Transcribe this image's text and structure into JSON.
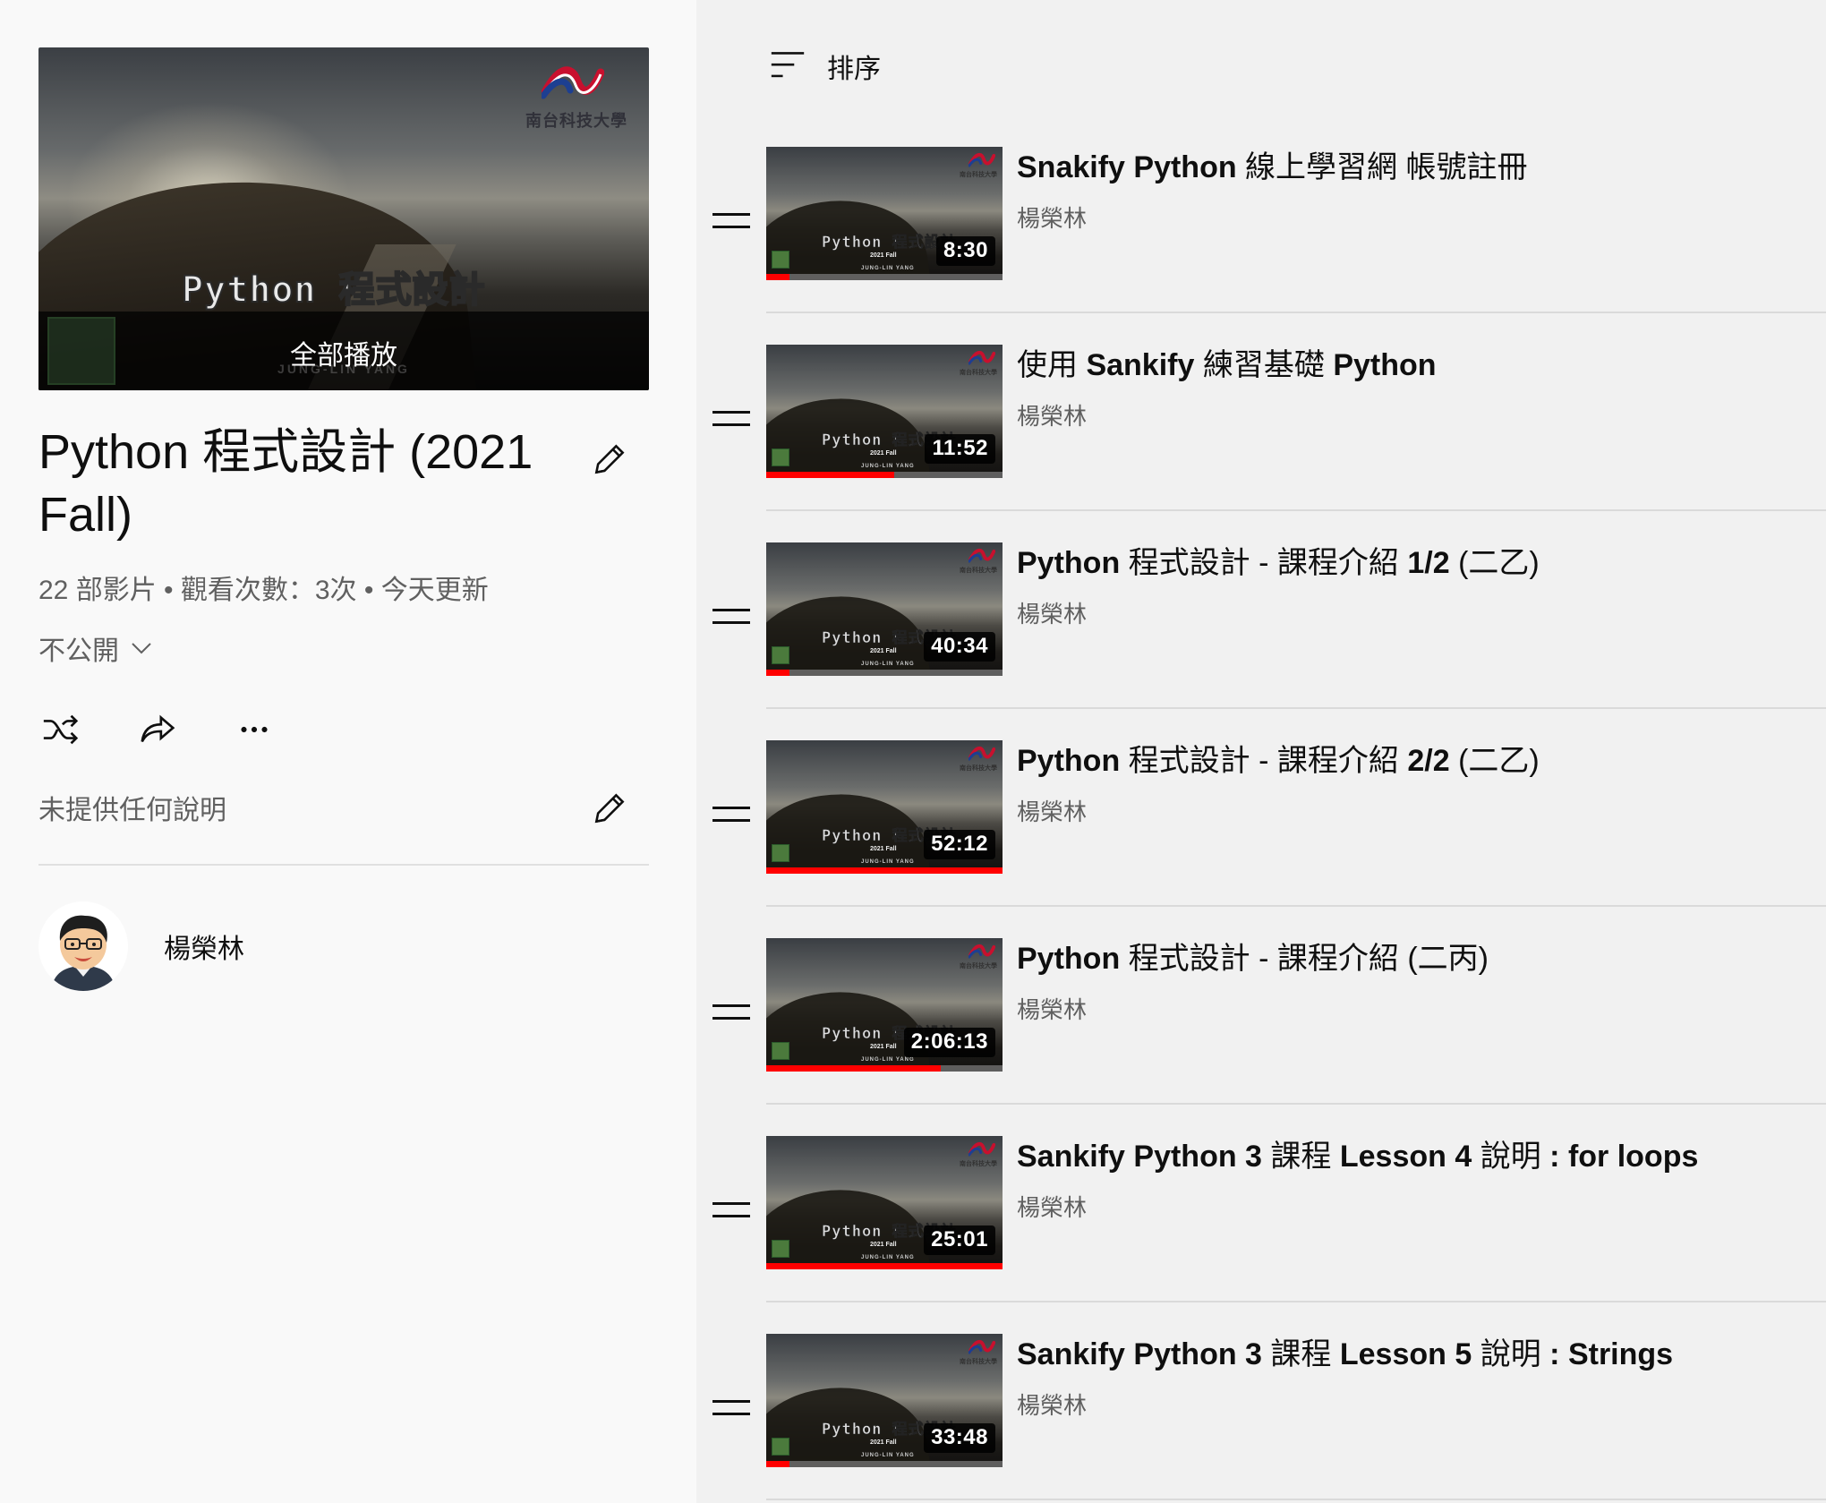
{
  "playlist": {
    "hero_title": "Python 程式設計",
    "hero_logo_text": "南台科技大學",
    "hero_ghost_text": "JUNG-LIN YANG",
    "hero_ghost_year": "2021 Fall",
    "play_all_label": "全部播放",
    "title": "Python 程式設計 (2021 Fall)",
    "stats": "22 部影片 • 觀看次數：3次 • 今天更新",
    "privacy_label": "不公開",
    "description": "未提供任何說明",
    "owner_name": "楊榮林"
  },
  "icons": {
    "edit": "pencil-icon",
    "shuffle": "shuffle-icon",
    "share": "share-icon",
    "more": "more-horizontal-icon",
    "chevron": "chevron-down-icon",
    "sort": "sort-icon",
    "drag": "drag-handle-icon"
  },
  "sort": {
    "label": "排序"
  },
  "colors": {
    "progress": "#ff0000",
    "accent_text": "#0f0f0f",
    "secondary_text": "#606060"
  },
  "videos": [
    {
      "title": "Snakify Python 線上學習網 帳號註冊",
      "channel": "楊榮林",
      "duration": "8:30",
      "progress": 0.1,
      "thumb_title": "Python 程式設計",
      "thumb_year": "2021 Fall",
      "thumb_author": "JUNG-LIN YANG"
    },
    {
      "title": "使用 Sankify 練習基礎 Python",
      "channel": "楊榮林",
      "duration": "11:52",
      "progress": 0.54,
      "thumb_title": "Python 程式設計",
      "thumb_year": "2021 Fall",
      "thumb_author": "JUNG-LIN YANG"
    },
    {
      "title": "Python 程式設計 - 課程介紹 1/2 (二乙)",
      "channel": "楊榮林",
      "duration": "40:34",
      "progress": 0.1,
      "thumb_title": "Python 程式設計",
      "thumb_year": "2021 Fall",
      "thumb_author": "JUNG-LIN YANG"
    },
    {
      "title": "Python 程式設計 - 課程介紹 2/2 (二乙)",
      "channel": "楊榮林",
      "duration": "52:12",
      "progress": 1.0,
      "thumb_title": "Python 程式設計",
      "thumb_year": "2021 Fall",
      "thumb_author": "JUNG-LIN YANG"
    },
    {
      "title": "Python 程式設計 - 課程介紹 (二丙)",
      "channel": "楊榮林",
      "duration": "2:06:13",
      "progress": 0.74,
      "thumb_title": "Python 程式設計",
      "thumb_year": "2021 Fall",
      "thumb_author": "JUNG-LIN YANG"
    },
    {
      "title": "Sankify Python 3 課程 Lesson 4 說明 : for loops",
      "channel": "楊榮林",
      "duration": "25:01",
      "progress": 1.0,
      "thumb_title": "Python 程式設計",
      "thumb_year": "2021 Fall",
      "thumb_author": "JUNG-LIN YANG"
    },
    {
      "title": "Sankify Python 3 課程 Lesson 5 說明 : Strings",
      "channel": "楊榮林",
      "duration": "33:48",
      "progress": 0.1,
      "thumb_title": "Python 程式設計",
      "thumb_year": "2021 Fall",
      "thumb_author": "JUNG-LIN YANG"
    }
  ]
}
